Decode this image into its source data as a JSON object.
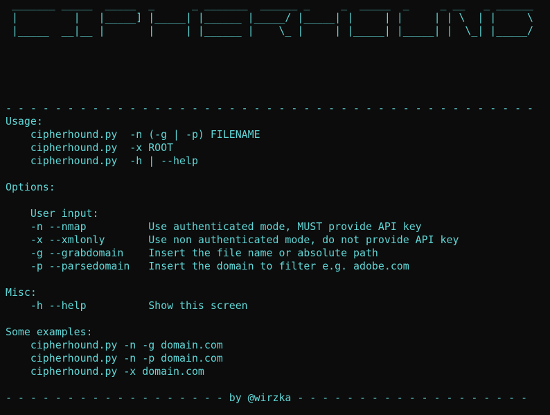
{
  "banner": {
    "line1": " _______ _____  _____  _      _ _______  ______ _     _  _____  _     _ __   _ ______ ",
    "line2": " |         |   |_____] |_____| |______ |_____/ |_____| |     | |     | | \\  | |     \\",
    "line3": " |_____  __|__ |       |     | |______ |    \\_ |     | |_____| |_____| |  \\_| |_____/"
  },
  "separator_top": "- - - - - - - - - - - - - - - - - - - - - - - - - - - - - - - - - - - - - - - - - - -",
  "usage": {
    "heading": "Usage:",
    "lines": [
      "    cipherhound.py  -n (-g | -p) FILENAME",
      "    cipherhound.py  -x ROOT",
      "    cipherhound.py  -h | --help"
    ]
  },
  "options": {
    "heading": "Options:",
    "user_input_heading": "    User input:",
    "lines": [
      "    -n --nmap          Use authenticated mode, MUST provide API key",
      "    -x --xmlonly       Use non authenticated mode, do not provide API key",
      "    -g --grabdomain    Insert the file name or absolute path",
      "    -p --parsedomain   Insert the domain to filter e.g. adobe.com"
    ]
  },
  "misc": {
    "heading": "Misc:",
    "lines": [
      "    -h --help          Show this screen"
    ]
  },
  "examples": {
    "heading": "Some examples:",
    "lines": [
      "    cipherhound.py -n -g domain.com",
      "    cipherhound.py -n -p domain.com",
      "    cipherhound.py -x domain.com"
    ]
  },
  "separator_bottom": "- - - - - - - - - - - - - - - - - - by @wirzka - - - - - - - - - - - - - - - - - - -",
  "colors": {
    "background": "#0c0c0c",
    "text": "#61d6d6"
  }
}
